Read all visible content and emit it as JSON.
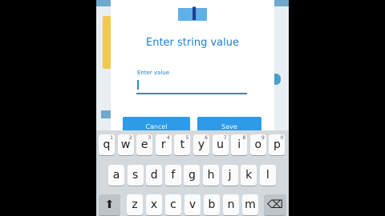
{
  "dialog": {
    "title": "Enter string value",
    "field_label": "Enter value",
    "field_value": "",
    "cancel_label": "Cancel",
    "save_label": "Save"
  },
  "keyboard": {
    "row1": [
      {
        "ch": "q",
        "num": "1"
      },
      {
        "ch": "w",
        "num": "2"
      },
      {
        "ch": "e",
        "num": "3"
      },
      {
        "ch": "r",
        "num": "4"
      },
      {
        "ch": "t",
        "num": "5"
      },
      {
        "ch": "y",
        "num": "6"
      },
      {
        "ch": "u",
        "num": "7"
      },
      {
        "ch": "i",
        "num": "8"
      },
      {
        "ch": "o",
        "num": "9"
      },
      {
        "ch": "p",
        "num": "0"
      }
    ],
    "row2": [
      "a",
      "s",
      "d",
      "f",
      "g",
      "h",
      "j",
      "k",
      "l"
    ],
    "row3": [
      "z",
      "x",
      "c",
      "v",
      "b",
      "n",
      "m"
    ],
    "shift_glyph": "⬆",
    "backspace_glyph": "⌫"
  },
  "colors": {
    "accent": "#1d7fd1",
    "button": "#2d9be8"
  }
}
